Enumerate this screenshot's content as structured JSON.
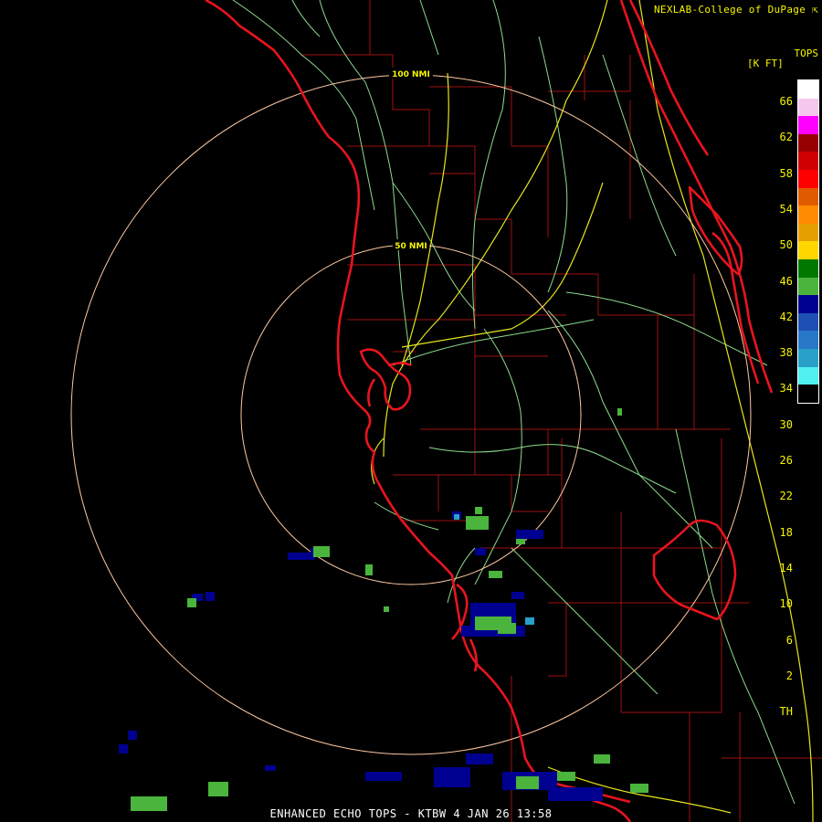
{
  "credit": "NEXLAB-College of DuPage",
  "credit_icon": "cursor-arrow-icon",
  "legend": {
    "title_line1": "TOPS",
    "title_line2": "[K FT]",
    "labels": [
      "66",
      "62",
      "58",
      "54",
      "50",
      "46",
      "42",
      "38",
      "34",
      "30",
      "26",
      "22",
      "18",
      "14",
      "10",
      "6",
      "2",
      "TH"
    ],
    "colors": [
      "#ffffff",
      "#f5c8f0",
      "#ff00ff",
      "#960000",
      "#d00000",
      "#ff0000",
      "#e05a00",
      "#ff8c00",
      "#e6a000",
      "#ffd700",
      "#007800",
      "#4ab43c",
      "#000090",
      "#1e50b4",
      "#2878c8",
      "#28a0c8",
      "#50f0f0",
      "#000000"
    ]
  },
  "range_rings": [
    {
      "label": "100 NMI"
    },
    {
      "label": "50 NMI"
    }
  ],
  "footer": "ENHANCED ECHO TOPS - KTBW 4 JAN 26 13:58",
  "colors": {
    "coast": "#e8141e",
    "county": "#a01010",
    "roads_major": "#e6e61e",
    "roads_minor": "#8cdc8c",
    "rings": "#ffc8a0"
  }
}
